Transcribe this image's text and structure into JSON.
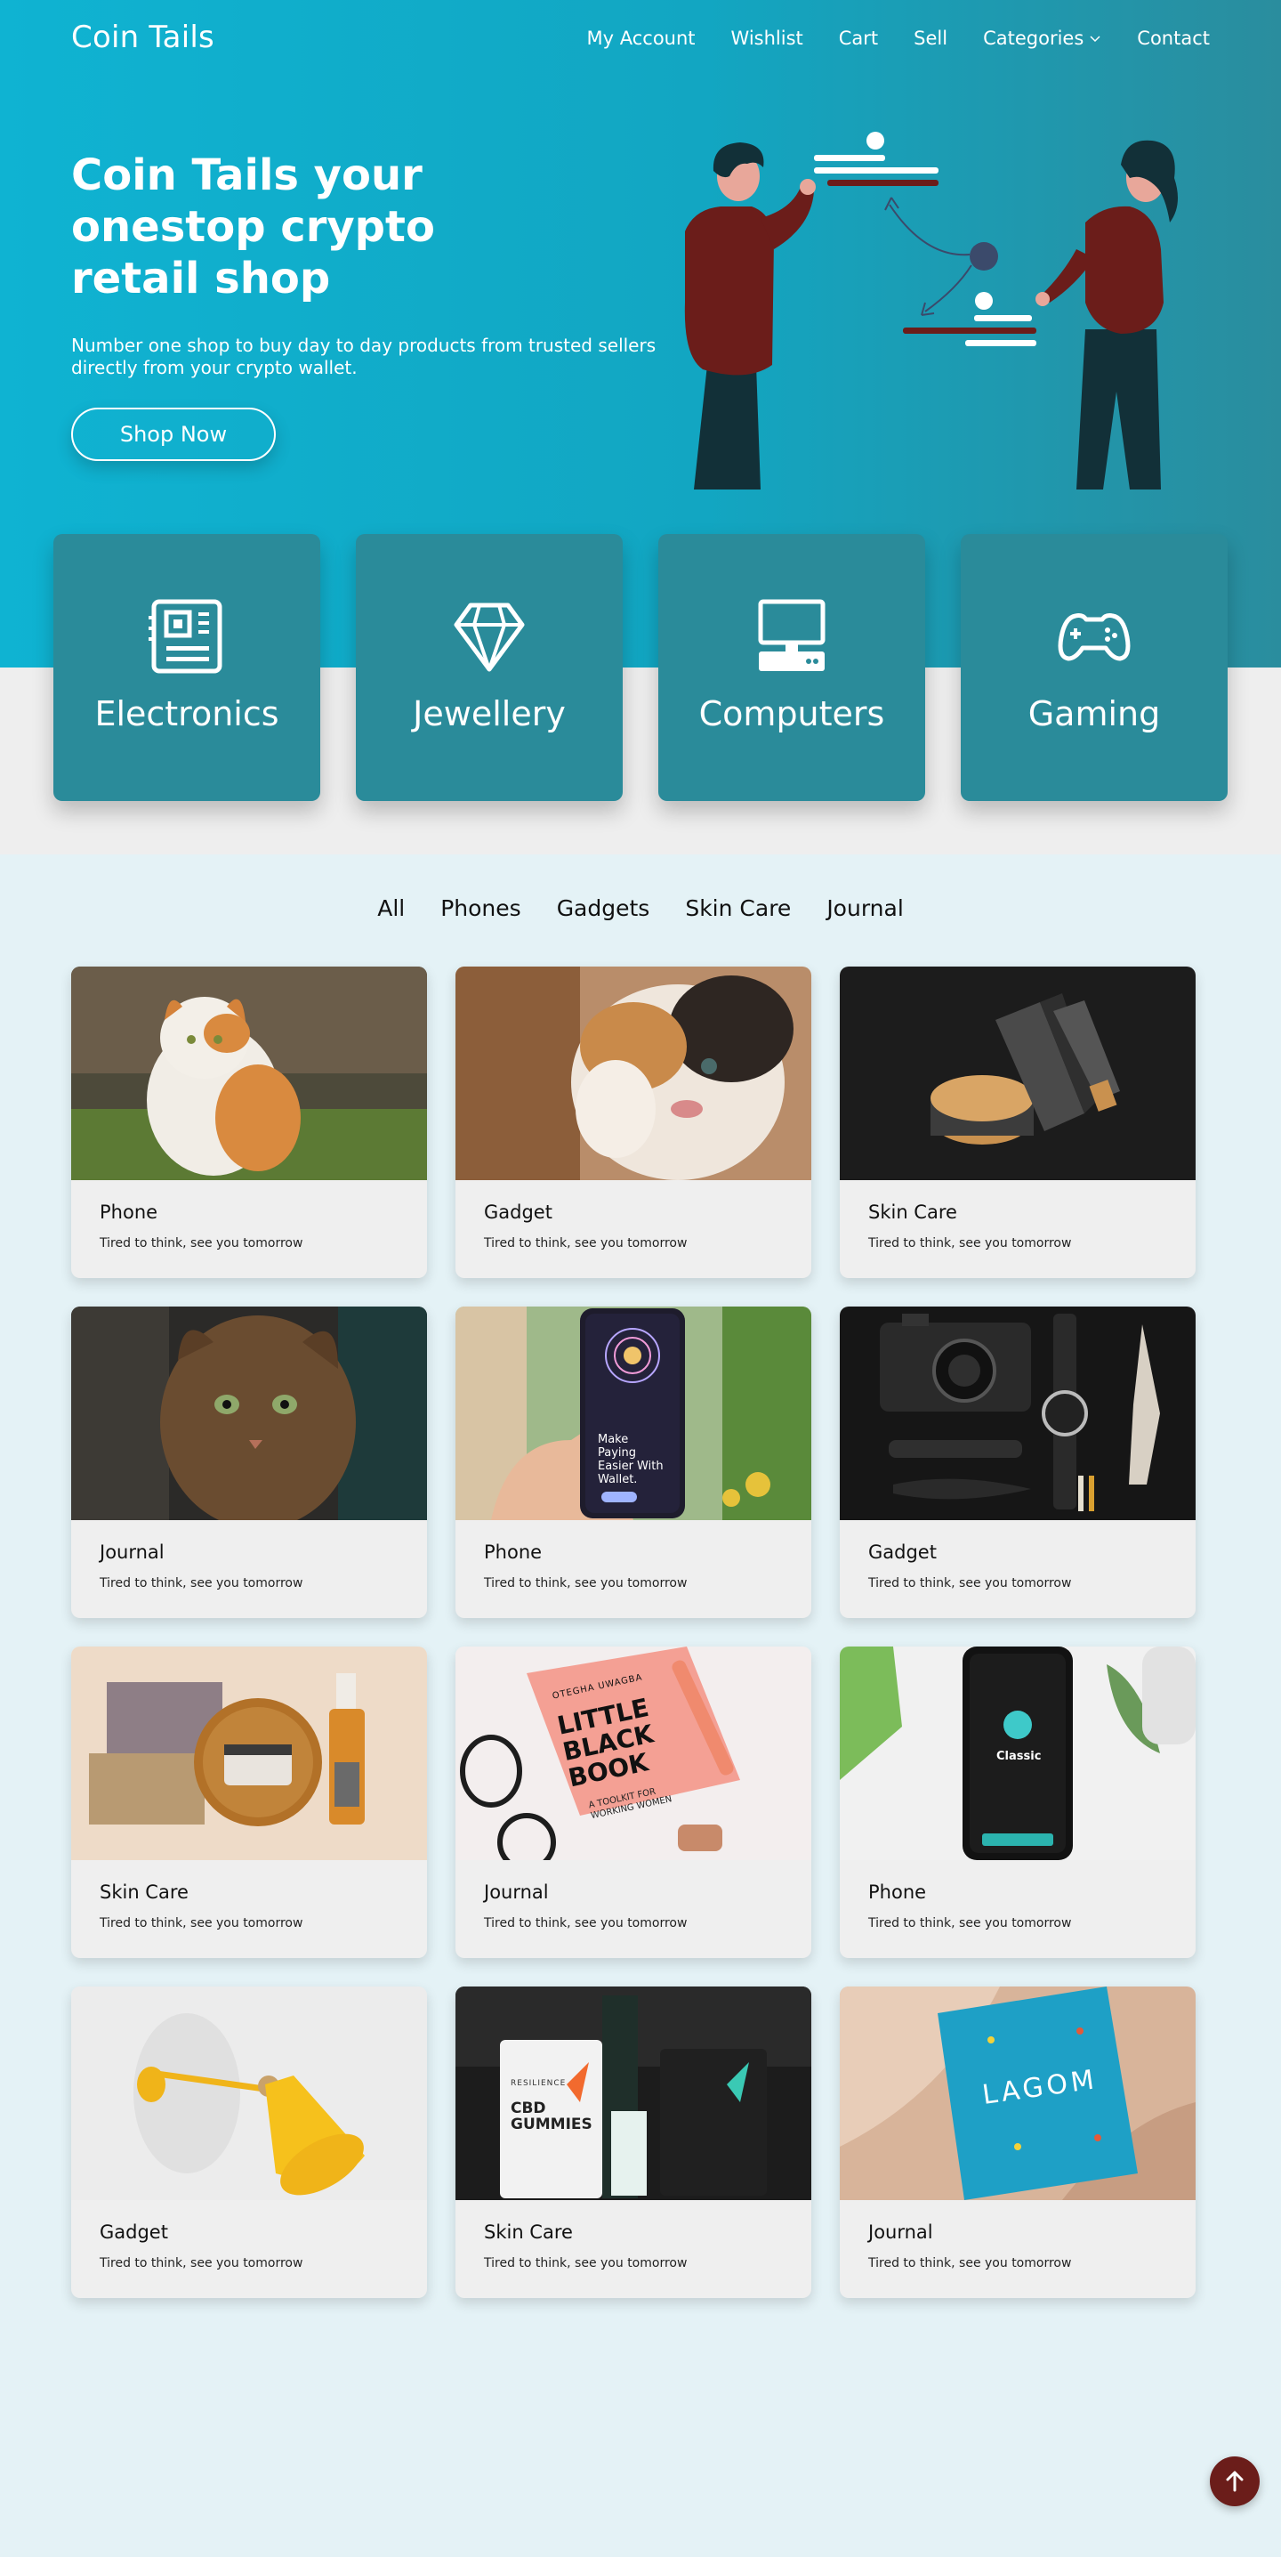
{
  "brand": {
    "name": "Coin Tails"
  },
  "nav": {
    "my_account": "My Account",
    "wishlist": "Wishlist",
    "cart": "Cart",
    "sell": "Sell",
    "categories": "Categories",
    "contact": "Contact"
  },
  "hero": {
    "title": "Coin Tails your onestop crypto retail shop",
    "subtitle": "Number one shop to buy day to day products from trusted sellers directly from your crypto wallet.",
    "cta": "Shop Now"
  },
  "categories": [
    {
      "label": "Electronics",
      "icon": "circuit-board-icon"
    },
    {
      "label": "Jewellery",
      "icon": "diamond-icon"
    },
    {
      "label": "Computers",
      "icon": "desktop-computer-icon"
    },
    {
      "label": "Gaming",
      "icon": "gamepad-icon"
    }
  ],
  "filters": [
    "All",
    "Phones",
    "Gadgets",
    "Skin Care",
    "Journal"
  ],
  "products": [
    {
      "title": "Phone",
      "desc": "Tired to think, see you tomorrow",
      "image": "orange-white-cat"
    },
    {
      "title": "Gadget",
      "desc": "Tired to think, see you tomorrow",
      "image": "kitten-licking-paw"
    },
    {
      "title": "Skin Care",
      "desc": "Tired to think, see you tomorrow",
      "image": "skincare-jars-dark"
    },
    {
      "title": "Journal",
      "desc": "Tired to think, see you tomorrow",
      "image": "tabby-cat-peeking"
    },
    {
      "title": "Phone",
      "desc": "Tired to think, see you tomorrow",
      "image": "hand-holding-phone"
    },
    {
      "title": "Gadget",
      "desc": "Tired to think, see you tomorrow",
      "image": "camera-watch-knife-flatlay"
    },
    {
      "title": "Skin Care",
      "desc": "Tired to think, see you tomorrow",
      "image": "cosmetics-set"
    },
    {
      "title": "Journal",
      "desc": "Tired to think, see you tomorrow",
      "image": "little-black-book"
    },
    {
      "title": "Phone",
      "desc": "Tired to think, see you tomorrow",
      "image": "phone-on-white-desk"
    },
    {
      "title": "Gadget",
      "desc": "Tired to think, see you tomorrow",
      "image": "yellow-wall-lamp"
    },
    {
      "title": "Skin Care",
      "desc": "Tired to think, see you tomorrow",
      "image": "cbd-gummies-packs"
    },
    {
      "title": "Journal",
      "desc": "Tired to think, see you tomorrow",
      "image": "lagom-book"
    }
  ],
  "image_text": {
    "phone_screen": "Make Paying Easier With Wallet.",
    "book_author": "OTEGHA UWAGBA",
    "book_title": "LITTLE BLACK BOOK",
    "book_tag": "A TOOLKIT FOR WORKING WOMEN",
    "phone_classic": "Classic",
    "gummies_brand": "RESILIENCE",
    "gummies_name": "CBD GUMMIES",
    "lagom": "LAGOM"
  },
  "colors": {
    "hero_start": "#0fb3d2",
    "hero_end": "#2a8d9e",
    "card_teal": "#2a8b9a",
    "accent_maroon": "#6b1d1a",
    "page_bg": "#e4f2f6"
  }
}
